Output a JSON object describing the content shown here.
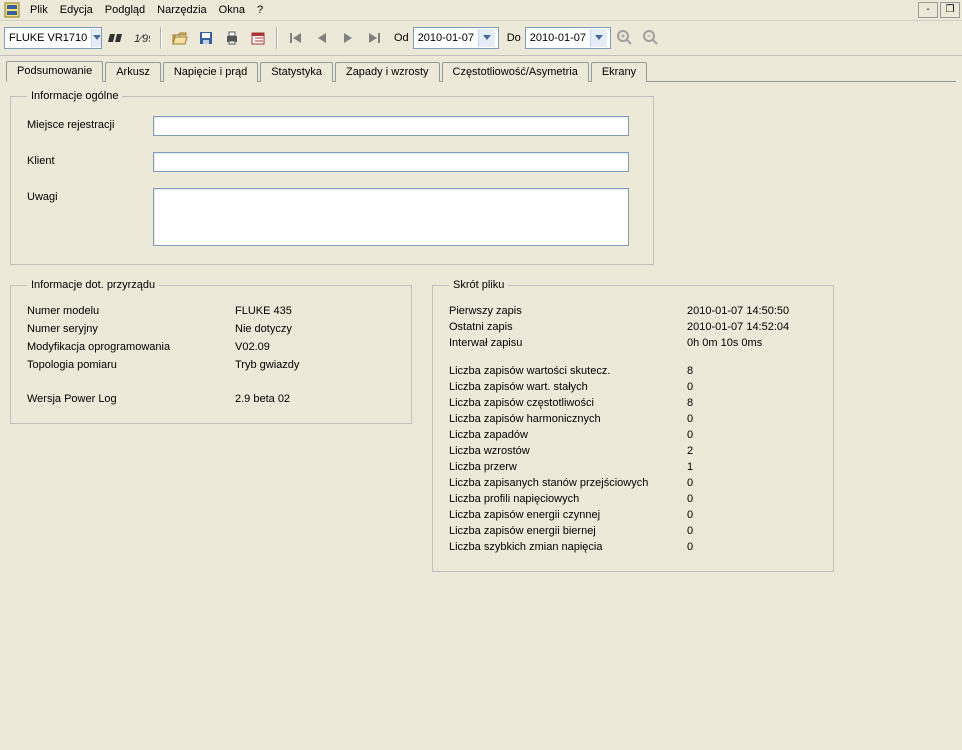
{
  "menu": {
    "items": [
      "Plik",
      "Edycja",
      "Podgląd",
      "Narzędzia",
      "Okna",
      "?"
    ]
  },
  "toolbar": {
    "device_combo": "FLUKE VR1710",
    "from_label": "Od",
    "from_date": "2010-01-07",
    "to_label": "Do",
    "to_date": "2010-01-07"
  },
  "tabs": [
    "Podsumowanie",
    "Arkusz",
    "Napięcie i prąd",
    "Statystyka",
    "Zapady i wzrosty",
    "Częstotliowość/Asymetria",
    "Ekrany"
  ],
  "general": {
    "legend": "Informacje ogólne",
    "place_label": "Miejsce rejestracji",
    "place_value": "",
    "client_label": "Klient",
    "client_value": "",
    "notes_label": "Uwagi",
    "notes_value": ""
  },
  "instrument": {
    "legend": "Informacje dot. przyrządu",
    "rows": [
      {
        "label": "Numer modelu",
        "value": "FLUKE 435"
      },
      {
        "label": "Numer seryjny",
        "value": "Nie dotyczy"
      },
      {
        "label": "Modyfikacja oprogramowania",
        "value": "V02.09"
      },
      {
        "label": "Topologia pomiaru",
        "value": "Tryb gwiazdy"
      }
    ],
    "power_label": "Wersja Power Log",
    "power_value": "2.9 beta 02"
  },
  "shortcut": {
    "legend": "Skrót pliku",
    "top": [
      {
        "label": "Pierwszy zapis",
        "value": "2010-01-07 14:50:50"
      },
      {
        "label": "Ostatni zapis",
        "value": "2010-01-07 14:52:04"
      },
      {
        "label": "Interwał zapisu",
        "value": "0h 0m 10s 0ms"
      }
    ],
    "counts": [
      {
        "label": "Liczba zapisów wartości skutecz.",
        "value": "8"
      },
      {
        "label": "Liczba zapisów wart. stałych",
        "value": "0"
      },
      {
        "label": "Liczba zapisów częstotliwości",
        "value": "8"
      },
      {
        "label": "Liczba zapisów harmonicznych",
        "value": "0"
      },
      {
        "label": "Liczba zapadów",
        "value": "0"
      },
      {
        "label": "Liczba wzrostów",
        "value": "2"
      },
      {
        "label": "Liczba przerw",
        "value": "1"
      },
      {
        "label": "Liczba zapisanych stanów przejściowych",
        "value": "0"
      },
      {
        "label": "Liczba profili napięciowych",
        "value": "0"
      },
      {
        "label": "Liczba zapisów energii czynnej",
        "value": "0"
      },
      {
        "label": "Liczba zapisów energii biernej",
        "value": "0"
      },
      {
        "label": "Liczba szybkich zmian napięcia",
        "value": "0"
      }
    ]
  }
}
